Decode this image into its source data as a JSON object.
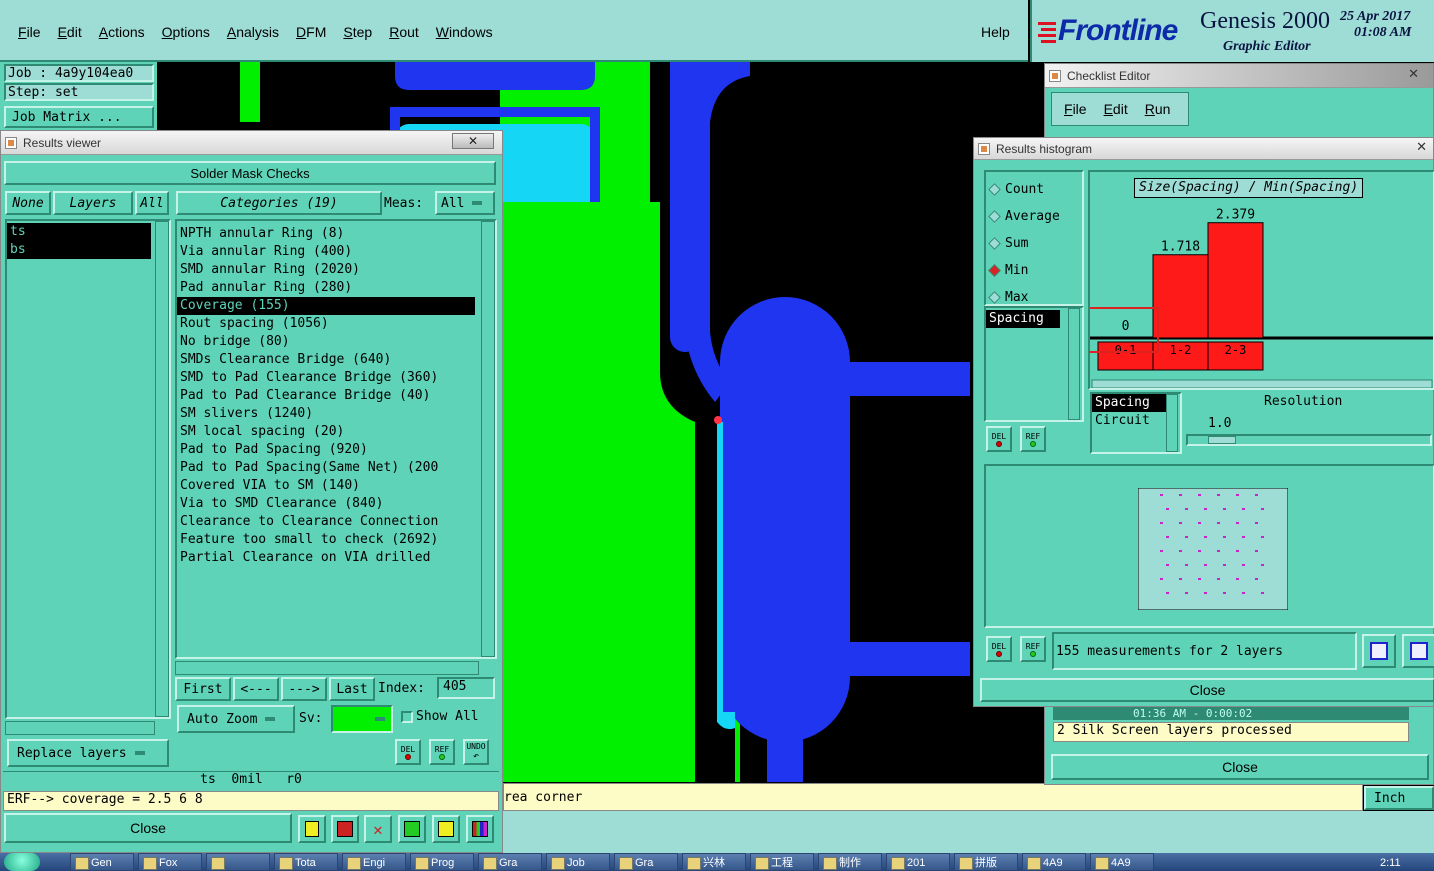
{
  "menubar": {
    "items": [
      "File",
      "Edit",
      "Actions",
      "Options",
      "Analysis",
      "DFM",
      "Step",
      "Rout",
      "Windows"
    ],
    "help": "Help"
  },
  "brand": {
    "logo_text": "Frontline",
    "product": "Genesis 2000",
    "subtitle": "Graphic Editor",
    "date": "25 Apr 2017",
    "time": "01:08 AM"
  },
  "job_panel": {
    "job": "Job : 4a9y104ea0",
    "step": "Step: set",
    "matrix_button": "Job Matrix ..."
  },
  "results_viewer": {
    "window_title": "Results viewer",
    "header": "Solder Mask Checks",
    "none_button": "None",
    "layers_button": "Layers",
    "all_button": "All",
    "layers": [
      "ts",
      "bs"
    ],
    "categories_button": "Categories (19)",
    "meas_label": "Meas:",
    "meas_value": "All",
    "categories": [
      "NPTH annular Ring (8)",
      "Via annular Ring (400)",
      "SMD annular Ring (2020)",
      "Pad annular Ring (280)",
      "Coverage (155)",
      "Rout spacing (1056)",
      "No bridge (80)",
      "SMDs Clearance Bridge (640)",
      "SMD to Pad Clearance Bridge (360)",
      "Pad to Pad Clearance Bridge (40)",
      "SM slivers (1240)",
      "SM local spacing (20)",
      "Pad to Pad Spacing (920)",
      "Pad to Pad Spacing(Same Net) (200",
      "Covered VIA to SM (140)",
      "Via to SMD Clearance (840)",
      "Clearance to Clearance Connection",
      "Feature too small to check (2692)",
      "Partial Clearance on VIA drilled"
    ],
    "selected_category_index": 4,
    "nav": {
      "first": "First",
      "prev": "<---",
      "next": "--->",
      "last": "Last",
      "index_label": "Index:",
      "index_value": "405"
    },
    "auto_zoom": "Auto Zoom",
    "sv_label": "Sv:",
    "show_all": "Show All",
    "replace_layers": "Replace layers",
    "icon_labels": {
      "del": "DEL",
      "ref": "REF",
      "undo": "UNDO"
    },
    "status_line": "ts  0mil   r0",
    "erf_line": "ERF--> coverage = 2.5 6 8",
    "close": "Close"
  },
  "checklist_editor": {
    "window_title": "Checklist Editor",
    "menu": [
      "File",
      "Edit",
      "Run"
    ],
    "log_time": "01:36 AM - 0:00:02",
    "log_line": "2 Silk Screen layers processed",
    "close": "Close"
  },
  "histogram": {
    "window_title": "Results histogram",
    "stat_options": [
      "Count",
      "Average",
      "Sum",
      "Min",
      "Max"
    ],
    "selected_stat": "Min",
    "chart_title": "Size(Spacing) / Min(Spacing)",
    "field_list": [
      "Spacing"
    ],
    "groupby_list": [
      "Spacing",
      "Circuit"
    ],
    "resolution_label": "Resolution",
    "resolution_value": "1.0",
    "summary": "155 measurements for 2 layers",
    "close": "Close",
    "icon_labels": {
      "del": "DEL",
      "ref": "REF"
    }
  },
  "chart_data": {
    "type": "bar",
    "title": "Size(Spacing) / Min(Spacing)",
    "categories": [
      "0-1",
      "1-2",
      "2-3"
    ],
    "values": [
      0,
      1.718,
      2.379
    ],
    "value_labels": [
      "0",
      "1.718",
      "2.379"
    ],
    "ylim": [
      0,
      2.6
    ],
    "bar_color": "#ff1a1a"
  },
  "main_status": {
    "message": "rea corner",
    "units": "Inch"
  },
  "taskbar": {
    "items": [
      "Gen",
      "Fox",
      "",
      "Tota",
      "Engi",
      "Prog",
      "Gra",
      "Job",
      "Gra",
      "兴林",
      "工程",
      "制作",
      "201",
      "拼版",
      "4A9",
      "4A9"
    ],
    "clock": "2:11"
  },
  "colors": {
    "panel_teal": "#5fd3b8",
    "light_teal": "#9edcd6",
    "pcb_green": "#00f000",
    "pcb_blue": "#1f35f0",
    "pcb_cyan": "#16d6f5",
    "status_yellow": "#fdfbc6"
  }
}
